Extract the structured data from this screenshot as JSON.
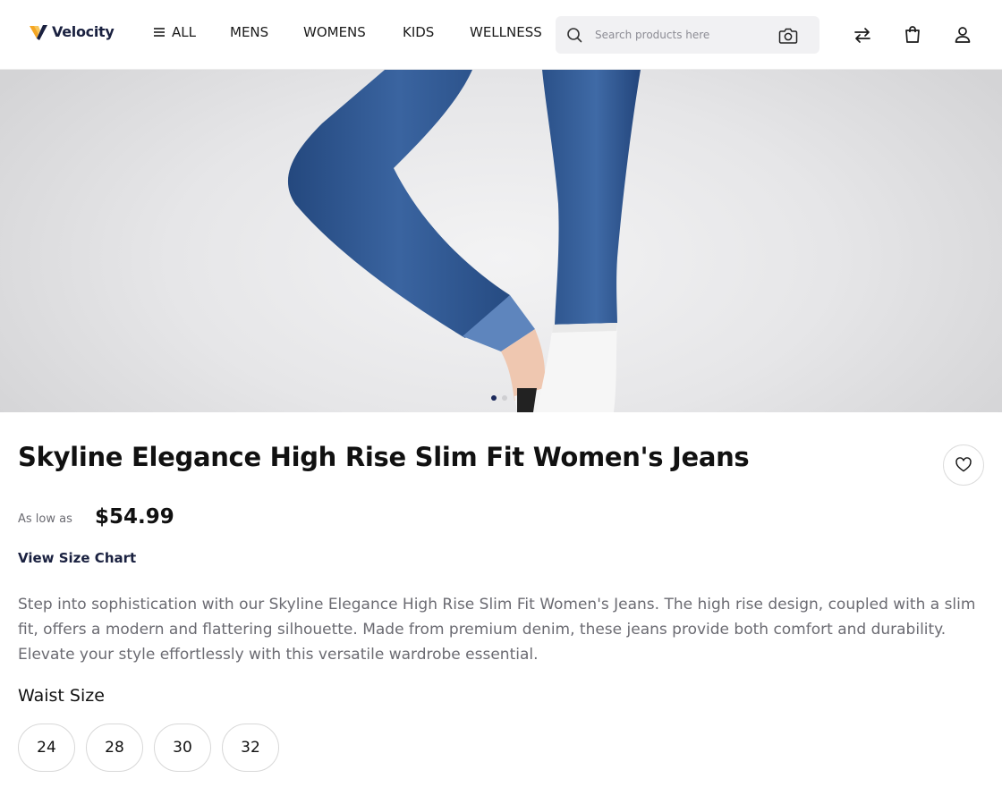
{
  "header": {
    "brand": "Velocity",
    "nav": [
      {
        "label": "ALL"
      },
      {
        "label": "MENS"
      },
      {
        "label": "WOMENS"
      },
      {
        "label": "KIDS"
      },
      {
        "label": "WELLNESS"
      }
    ],
    "search_placeholder": "Search products here",
    "icons": [
      "menu-icon",
      "search-icon",
      "camera-icon",
      "compare-icon",
      "bag-icon",
      "user-icon"
    ]
  },
  "hero": {
    "image": "woman-legs-blue-jeans-white-sneakers",
    "slides": 2,
    "active_slide": 1
  },
  "product": {
    "title": "Skyline Elegance High Rise Slim Fit Women's Jeans",
    "price_prefix": "As low as",
    "price": "$54.99",
    "size_chart_link": "View Size Chart",
    "description": "Step into sophistication with our Skyline Elegance High Rise Slim Fit Women's Jeans. The high rise design, coupled with a slim fit, offers a modern and flattering silhouette. Made from premium denim, these jeans provide both comfort and durability. Elevate your style effortlessly with this versatile wardrobe essential.",
    "size_label": "Waist Size",
    "sizes": [
      "24",
      "28",
      "30",
      "32"
    ]
  },
  "colors": {
    "brand_navy": "#1a2140",
    "logo_orange": "#f5a623",
    "denim": "#2f568f",
    "dot_active": "#1c2a5c"
  }
}
